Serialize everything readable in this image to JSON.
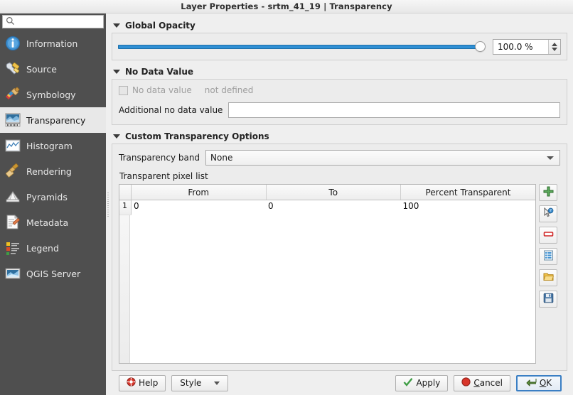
{
  "window": {
    "title": "Layer Properties - srtm_41_19 | Transparency"
  },
  "sidebar": {
    "search": {
      "value": "",
      "placeholder": "",
      "icon": "search-icon"
    },
    "items": [
      {
        "label": "Information",
        "icon": "information-icon",
        "selected": false
      },
      {
        "label": "Source",
        "icon": "source-icon",
        "selected": false
      },
      {
        "label": "Symbology",
        "icon": "symbology-icon",
        "selected": false
      },
      {
        "label": "Transparency",
        "icon": "transparency-icon",
        "selected": true
      },
      {
        "label": "Histogram",
        "icon": "histogram-icon",
        "selected": false
      },
      {
        "label": "Rendering",
        "icon": "rendering-icon",
        "selected": false
      },
      {
        "label": "Pyramids",
        "icon": "pyramids-icon",
        "selected": false
      },
      {
        "label": "Metadata",
        "icon": "metadata-icon",
        "selected": false
      },
      {
        "label": "Legend",
        "icon": "legend-icon",
        "selected": false
      },
      {
        "label": "QGIS Server",
        "icon": "qgis-server-icon",
        "selected": false
      }
    ]
  },
  "global_opacity": {
    "title": "Global Opacity",
    "slider_percent": 100,
    "value_text": "100.0 %"
  },
  "no_data_value": {
    "title": "No Data Value",
    "checkbox_label": "No data value",
    "checkbox_checked": false,
    "checkbox_enabled": false,
    "state_text": "not defined",
    "additional_label": "Additional no data value",
    "additional_value": "",
    "additional_placeholder": ""
  },
  "custom_transparency": {
    "title": "Custom Transparency Options",
    "band_label": "Transparency band",
    "band_value": "None",
    "band_options": [
      "None"
    ],
    "pixel_list_label": "Transparent pixel list",
    "columns": [
      "From",
      "To",
      "Percent Transparent"
    ],
    "rows": [
      {
        "index": "1",
        "from": "0",
        "to": "0",
        "percent": "100"
      }
    ],
    "tools": [
      {
        "name": "add-values-manually-button",
        "icon": "green-plus-icon"
      },
      {
        "name": "add-values-from-display-button",
        "icon": "cursor-pick-icon"
      },
      {
        "name": "remove-selected-row-button",
        "icon": "red-minus-icon"
      },
      {
        "name": "default-values-button",
        "icon": "blue-list-icon"
      },
      {
        "name": "import-from-file-button",
        "icon": "folder-open-icon"
      },
      {
        "name": "export-to-file-button",
        "icon": "floppy-save-icon"
      }
    ]
  },
  "buttons": {
    "help": "Help",
    "style": "Style",
    "apply": "Apply",
    "cancel": "Cancel",
    "ok": "OK"
  },
  "colors": {
    "accent": "#2f8fd4",
    "sidebar_bg": "#4f4f4f",
    "selected_bg": "#e8e8e8",
    "focus_border": "#3b7fc4",
    "panel_bg": "#efefef"
  }
}
